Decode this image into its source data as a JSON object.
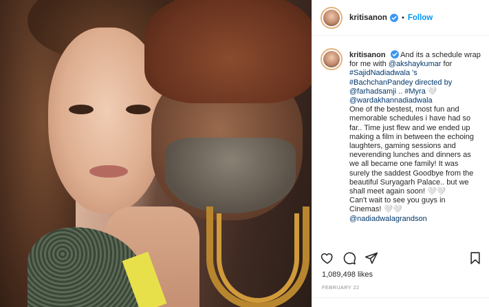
{
  "post": {
    "image_alt": "Two people posing closely together",
    "header": {
      "username": "kritisanon",
      "verified": true,
      "separator": "•",
      "follow_label": "Follow"
    },
    "caption": {
      "username": "kritisanon",
      "lines": [
        "And its a schedule wrap",
        "for me with ",
        "#SajidNadiadwala 's",
        "#BachchanPandey directed by",
        "@farhadsamji .. #Myra 🤍",
        "@wardakhannadiadwala",
        "One of the bestest, most fun and",
        "memorable schedules i have had so",
        "far.. Time just flew and we ended up",
        "making a film in between the echoing",
        "laughters, gaming sessions and",
        "neverending lunches and dinners as",
        "we all became one family! It was",
        "surely the saddest Goodbye from the",
        "beautiful Suryagarh Palace.. but we",
        "shall meet again soon! 🤍🤍",
        "Can't wait to see you guys in",
        "Cinemas! 🤍🤍",
        "@nadiadwalagrandson"
      ],
      "mention_akshay": "@akshaykumar",
      "for_text": " for"
    },
    "likes": "1,089,498 likes",
    "date": "FEBRUARY 22"
  },
  "colors": {
    "link_blue": "#0095f6",
    "mention": "#00376b",
    "text": "#262626",
    "muted": "#8e8e8e"
  },
  "icons": {
    "like": "heart-icon",
    "comment": "comment-icon",
    "share": "share-icon",
    "save": "bookmark-icon",
    "verified": "verified-badge-icon"
  }
}
